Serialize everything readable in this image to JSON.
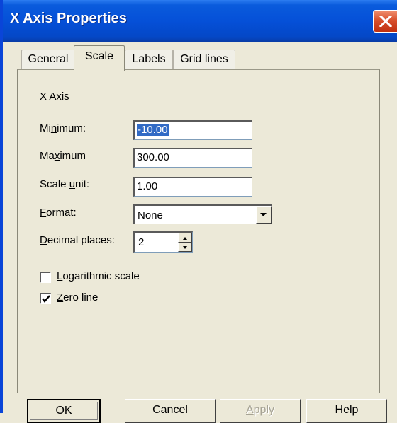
{
  "window": {
    "title": "X Axis Properties"
  },
  "tabs": [
    {
      "label": "General",
      "active": false
    },
    {
      "label": "Scale",
      "active": true
    },
    {
      "label": "Labels",
      "active": false
    },
    {
      "label": "Grid lines",
      "active": false
    }
  ],
  "scale": {
    "group_label": "X Axis",
    "minimum": {
      "label_pre": "Mi",
      "label_mn": "n",
      "label_post": "imum:",
      "value": "-10.00"
    },
    "maximum": {
      "label_pre": "Ma",
      "label_mn": "x",
      "label_post": "imum",
      "value": "300.00"
    },
    "scale_unit": {
      "label_pre": "Scale ",
      "label_mn": "u",
      "label_post": "nit:",
      "value": "1.00"
    },
    "format": {
      "label_mn": "F",
      "label_post": "ormat:",
      "value": "None"
    },
    "decimal_places": {
      "label_mn": "D",
      "label_post": "ecimal places:",
      "value": "2"
    },
    "logarithmic": {
      "label_mn": "L",
      "label_post": "ogarithmic scale",
      "checked": false
    },
    "zero_line": {
      "label_mn": "Z",
      "label_post": "ero line",
      "checked": true
    }
  },
  "buttons": {
    "ok": "OK",
    "cancel": "Cancel",
    "apply_mn": "A",
    "apply_post": "pply",
    "help": "Help"
  },
  "colors": {
    "titlebar": "#0550d8",
    "close": "#d8502c",
    "dialog": "#ece9d8",
    "selection": "#316ac5"
  }
}
